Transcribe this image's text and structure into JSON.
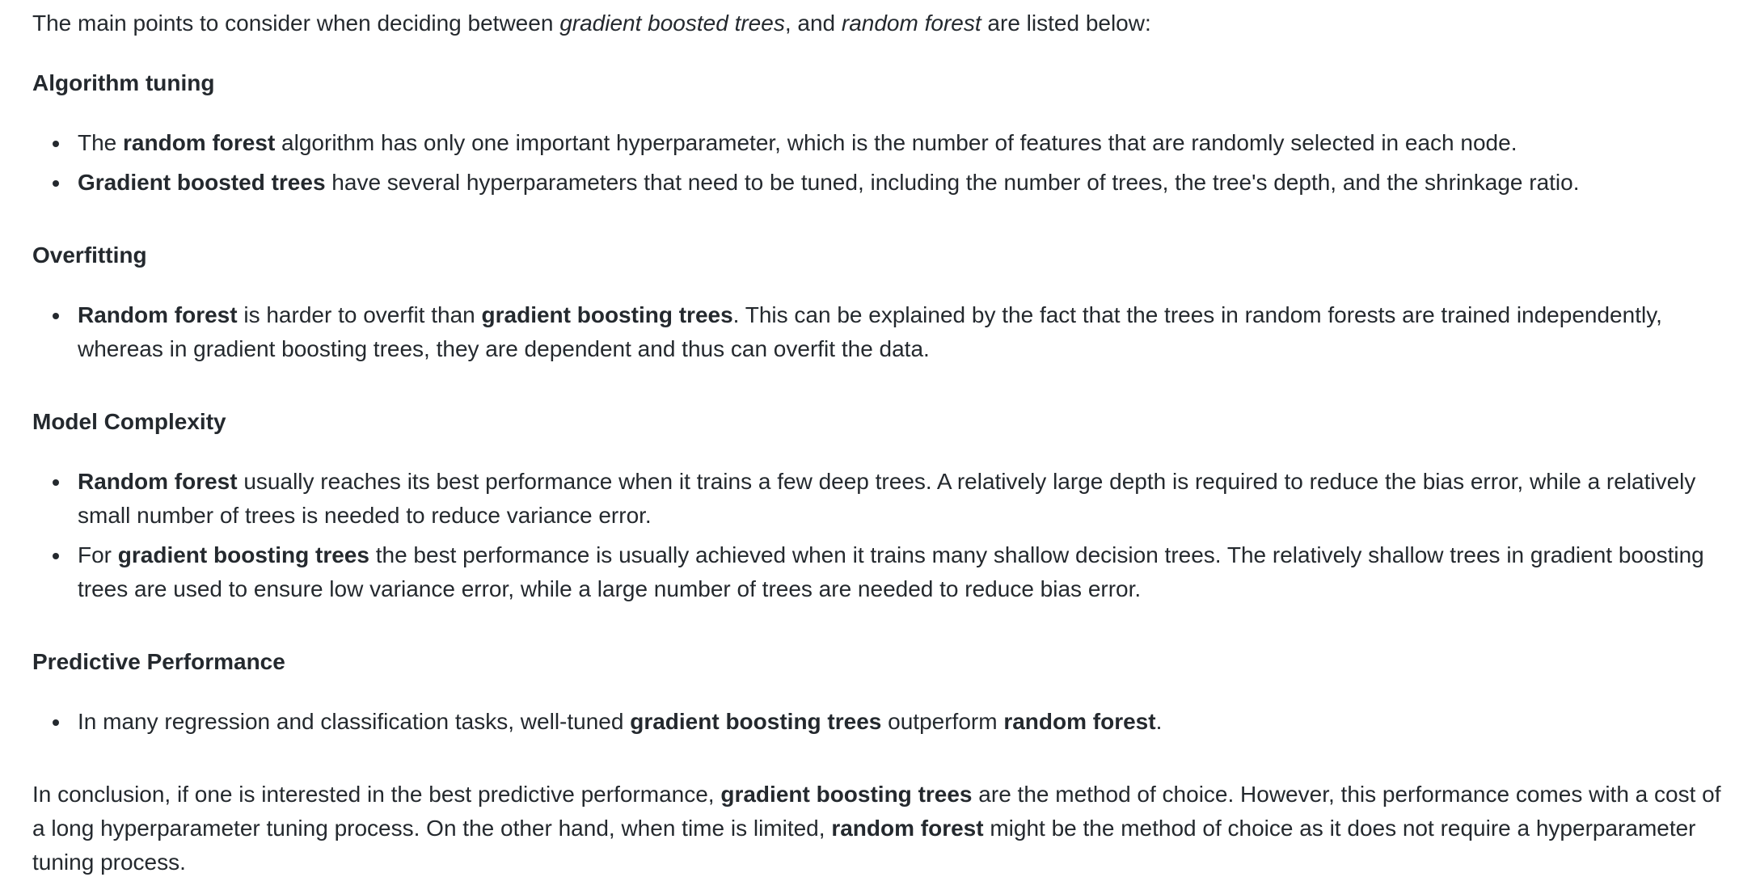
{
  "intro": {
    "t1": "The main points to consider when deciding between ",
    "i1": "gradient boosted trees",
    "t2": ", and ",
    "i2": "random forest",
    "t3": " are listed below:"
  },
  "sections": [
    {
      "title": "Algorithm tuning",
      "items": [
        {
          "t1": "The ",
          "b1": "random forest",
          "t2": " algorithm has only one important hyperparameter, which is the number of features that are randomly selected in each node."
        },
        {
          "b1": "Gradient boosted trees",
          "t1": " have several hyperparameters that need to be tuned, including the number of trees, the tree's depth, and the shrinkage ratio."
        }
      ]
    },
    {
      "title": "Overfitting",
      "items": [
        {
          "b1": "Random forest",
          "t1": " is harder to overfit than ",
          "b2": "gradient boosting trees",
          "t2": ". This can be explained by the fact that the trees in random forests are trained independently, whereas in gradient boosting trees, they are dependent and thus can overfit the data."
        }
      ]
    },
    {
      "title": "Model Complexity",
      "items": [
        {
          "b1": "Random forest",
          "t1": " usually reaches its best performance when it trains a few deep trees. A relatively large depth is required to reduce the bias error, while a relatively small number of trees is needed to reduce variance error."
        },
        {
          "t1": "For ",
          "b1": "gradient boosting trees",
          "t2": " the best performance is usually achieved when it trains many shallow decision trees. The relatively shallow trees in gradient boosting trees are used to ensure low variance error, while a large number of trees are needed to reduce bias error."
        }
      ]
    },
    {
      "title": "Predictive Performance",
      "items": [
        {
          "t1": "In many regression and classification tasks, well-tuned ",
          "b1": "gradient boosting trees",
          "t2": " outperform ",
          "b2": "random forest",
          "t3": "."
        }
      ]
    }
  ],
  "conclusion": {
    "t1": "In conclusion, if one is interested in the best predictive performance, ",
    "b1": "gradient boosting trees",
    "t2": " are the method of choice. However, this performance comes with a cost of a long hyperparameter tuning process. On the other hand, when time is limited, ",
    "b2": "random forest",
    "t3": " might be the method of choice as it does not require a hyperparameter tuning process."
  }
}
